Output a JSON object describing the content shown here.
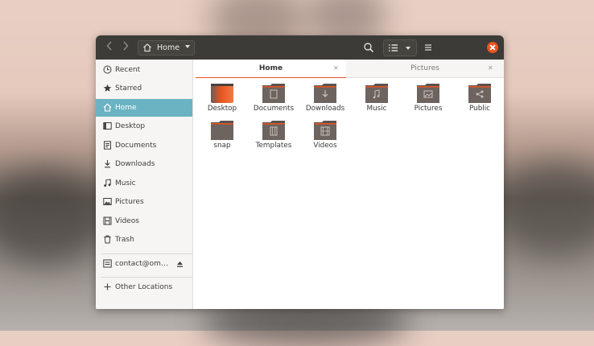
{
  "headerbar": {
    "path_label": "Home"
  },
  "sidebar": {
    "items": [
      {
        "label": "Recent",
        "icon": "clock-icon"
      },
      {
        "label": "Starred",
        "icon": "star-icon"
      },
      {
        "label": "Home",
        "icon": "home-icon",
        "active": true
      },
      {
        "label": "Desktop",
        "icon": "desktop-icon"
      },
      {
        "label": "Documents",
        "icon": "document-icon"
      },
      {
        "label": "Downloads",
        "icon": "download-icon"
      },
      {
        "label": "Music",
        "icon": "music-icon"
      },
      {
        "label": "Pictures",
        "icon": "picture-icon"
      },
      {
        "label": "Videos",
        "icon": "video-icon"
      },
      {
        "label": "Trash",
        "icon": "trash-icon"
      }
    ],
    "account": {
      "label": "contact@om…",
      "icon": "account-icon"
    },
    "other": {
      "label": "Other Locations",
      "icon": "plus-icon"
    }
  },
  "tabs": [
    {
      "label": "Home",
      "active": true
    },
    {
      "label": "Pictures",
      "active": false
    }
  ],
  "files": [
    {
      "label": "Desktop",
      "icon": "desktop-folder-icon"
    },
    {
      "label": "Documents",
      "icon": "documents-folder-icon"
    },
    {
      "label": "Downloads",
      "icon": "downloads-folder-icon"
    },
    {
      "label": "Music",
      "icon": "music-folder-icon"
    },
    {
      "label": "Pictures",
      "icon": "pictures-folder-icon"
    },
    {
      "label": "Public",
      "icon": "public-folder-icon"
    },
    {
      "label": "snap",
      "icon": "folder-icon"
    },
    {
      "label": "Templates",
      "icon": "templates-folder-icon"
    },
    {
      "label": "Videos",
      "icon": "videos-folder-icon"
    }
  ],
  "colors": {
    "accent": "#e95420",
    "selection": "#6bb3c2",
    "headerbar": "#3c3b37",
    "folder": "#6d645f"
  }
}
